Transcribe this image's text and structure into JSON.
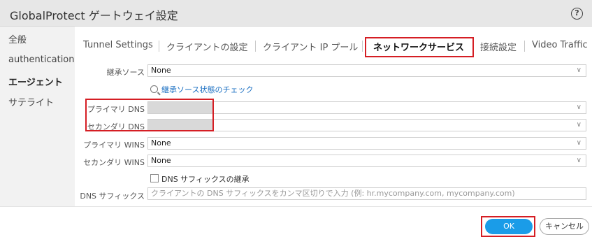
{
  "window": {
    "title": "GlobalProtect ゲートウェイ設定",
    "help_icon": "?"
  },
  "sidebar": {
    "items": [
      {
        "label": "全般",
        "active": false
      },
      {
        "label": "authentication",
        "active": false
      },
      {
        "label": "エージェント",
        "active": true
      },
      {
        "label": "サテライト",
        "active": false
      }
    ]
  },
  "tabs": [
    {
      "label": "Tunnel Settings",
      "active": false
    },
    {
      "label": "クライアントの設定",
      "active": false
    },
    {
      "label": "クライアント IP プール",
      "active": false
    },
    {
      "label": "ネットワークサービス",
      "active": true
    },
    {
      "label": "接続設定",
      "active": false
    },
    {
      "label": "Video Traffic",
      "active": false
    }
  ],
  "form": {
    "inherit_source": {
      "label": "継承ソース",
      "value": "None"
    },
    "check_link": "継承ソース状態のチェック",
    "primary_dns": {
      "label": "プライマリ DNS",
      "value": ""
    },
    "secondary_dns": {
      "label": "セカンダリ DNS",
      "value": ""
    },
    "primary_wins": {
      "label": "プライマリ WINS",
      "value": "None"
    },
    "secondary_wins": {
      "label": "セカンダリ WINS",
      "value": "None"
    },
    "dns_suffix_inherit": {
      "label": "DNS サフィックスの継承",
      "checked": false
    },
    "dns_suffix": {
      "label": "DNS サフィックス",
      "placeholder": "クライアントの DNS サフィックスをカンマ区切りで入力 (例: hr.mycompany.com, mycompany.com)"
    }
  },
  "buttons": {
    "ok": "OK",
    "cancel": "キャンセル"
  },
  "colors": {
    "highlight": "#d51e24",
    "primary_button": "#1a9ce8",
    "link": "#1a6fc2"
  }
}
